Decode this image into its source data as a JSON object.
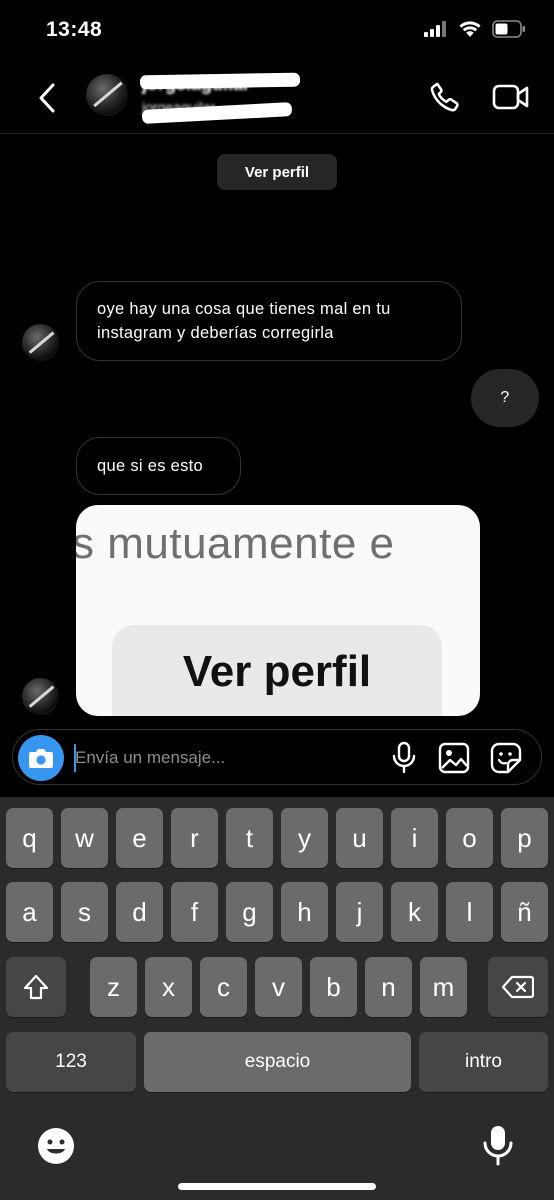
{
  "status_bar": {
    "time": "13:48"
  },
  "header": {
    "contact_name": "jorge.aguilar",
    "contact_username": "jorgeaguilar"
  },
  "profile_pill": {
    "label": "Ver perfil"
  },
  "messages": [
    {
      "direction": "incoming",
      "text": "oye hay una cosa que tienes mal en tu instagram y deberías corregirla"
    },
    {
      "direction": "outgoing",
      "text": "?"
    },
    {
      "direction": "incoming",
      "text": "que si es esto"
    }
  ],
  "image_message": {
    "caption_text": "s mutuamente e",
    "button_text": "Ver perfil"
  },
  "composer": {
    "placeholder": "Envía un mensaje..."
  },
  "keyboard": {
    "row1": [
      "q",
      "w",
      "e",
      "r",
      "t",
      "y",
      "u",
      "i",
      "o",
      "p"
    ],
    "row2": [
      "a",
      "s",
      "d",
      "f",
      "g",
      "h",
      "j",
      "k",
      "l",
      "ñ"
    ],
    "row3": [
      "z",
      "x",
      "c",
      "v",
      "b",
      "n",
      "m"
    ],
    "numbers_label": "123",
    "space_label": "espacio",
    "return_label": "intro"
  },
  "colors": {
    "background": "#000000",
    "accent": "#3797f0",
    "outgoing_bubble": "#262626",
    "key": "#6b6b6b",
    "key_dark": "#464646",
    "keyboard_bg": "#2b2b2b"
  },
  "icons": {
    "signal": "signal-icon",
    "wifi": "wifi-icon",
    "battery": "battery-icon",
    "back": "chevron-left-icon",
    "call": "phone-icon",
    "video": "video-camera-icon",
    "camera": "camera-icon",
    "mic": "microphone-icon",
    "gallery": "image-icon",
    "sticker": "sticker-icon",
    "shift": "shift-icon",
    "delete": "backspace-icon",
    "emoji": "emoji-icon",
    "dictation": "dictation-icon"
  }
}
